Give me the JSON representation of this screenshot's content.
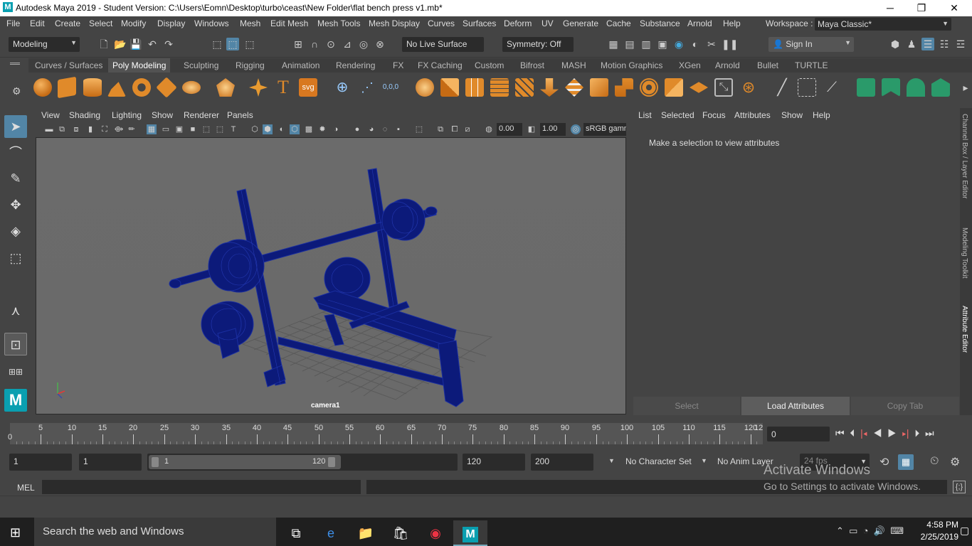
{
  "window": {
    "title": "Autodesk Maya 2019 - Student Version: C:\\Users\\Eomn\\Desktop\\turbo\\ceast\\New Folder\\flat bench press v1.mb*",
    "logo": "M",
    "minimize": "─",
    "maximize": "❐",
    "close": "✕"
  },
  "menubar": {
    "items": [
      "File",
      "Edit",
      "Create",
      "Select",
      "Modify",
      "Display",
      "Windows",
      "Mesh",
      "Edit Mesh",
      "Mesh Tools",
      "Mesh Display",
      "Curves",
      "Surfaces",
      "Deform",
      "UV",
      "Generate",
      "Cache",
      "Substance",
      "Arnold",
      "Help"
    ],
    "workspace_label": "Workspace :",
    "workspace_value": "Maya Classic*"
  },
  "statusline": {
    "menuset": "Modeling",
    "live_surface": "No Live Surface",
    "symmetry": "Symmetry: Off",
    "sign_in": "Sign In"
  },
  "shelf": {
    "tabs": [
      "Curves / Surfaces",
      "Poly Modeling",
      "Sculpting",
      "Rigging",
      "Animation",
      "Rendering",
      "FX",
      "FX Caching",
      "Custom",
      "Bifrost",
      "MASH",
      "Motion Graphics",
      "XGen",
      "Arnold",
      "Bullet",
      "TURTLE"
    ],
    "active_tab": "Poly Modeling",
    "text_icon": "T",
    "svg_icon": "svg",
    "xyz_icon": "0,0,0"
  },
  "panel": {
    "menu": [
      "View",
      "Shading",
      "Lighting",
      "Show",
      "Renderer",
      "Panels"
    ],
    "exposure": "0.00",
    "gamma": "1.00",
    "colorspace": "sRGB gamma",
    "camera_label": "camera1"
  },
  "attribute_editor": {
    "menu": [
      "List",
      "Selected",
      "Focus",
      "Attributes",
      "Show",
      "Help"
    ],
    "message": "Make a selection to view attributes",
    "buttons": [
      "Select",
      "Load Attributes",
      "Copy Tab"
    ]
  },
  "side_tabs": [
    "Channel Box / Layer Editor",
    "Modeling Toolkit",
    "Attribute Editor"
  ],
  "timeline": {
    "ticks": [
      5,
      10,
      15,
      20,
      25,
      30,
      35,
      40,
      45,
      50,
      55,
      60,
      65,
      70,
      75,
      80,
      85,
      90,
      95,
      100,
      105,
      110,
      115,
      120
    ],
    "current_frame": "0",
    "first_label": "0",
    "end_label": "12"
  },
  "range": {
    "start": "1",
    "playback_start": "1",
    "slider_start": "1",
    "slider_end": "120",
    "playback_end": "120",
    "end": "200",
    "character_set": "No Character Set",
    "anim_layer": "No Anim Layer",
    "fps": "24 fps"
  },
  "command": {
    "label": "MEL"
  },
  "watermark": {
    "line1": "Activate Windows",
    "line2": "Go to Settings to activate Windows."
  },
  "taskbar": {
    "search": "Search the web and Windows",
    "time": "4:58 PM",
    "date": "2/25/2019"
  },
  "colors": {
    "model": "#0c1a7a",
    "accent": "#5285a6",
    "shelf_icon": "#e08a2a"
  }
}
